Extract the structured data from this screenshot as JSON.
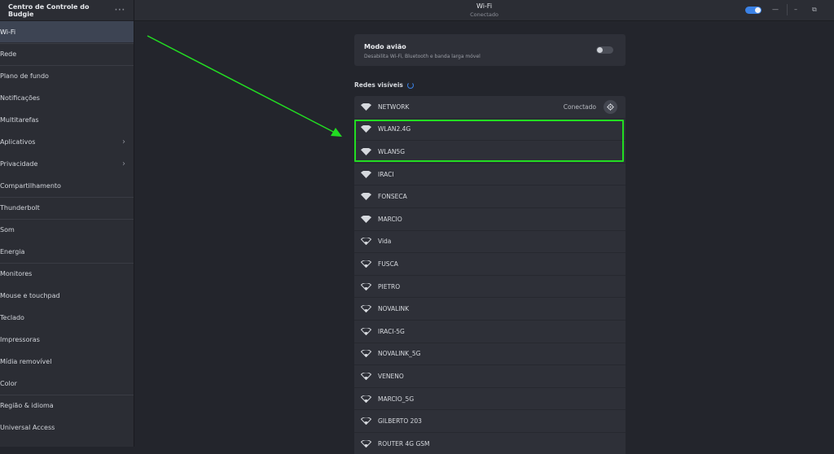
{
  "sidebar": {
    "title": "Centro de Controle do Budgie",
    "menu_icon": "more-dots-icon",
    "items": [
      {
        "label": "Wi-Fi",
        "active": true,
        "chevron": false,
        "sep": false
      },
      {
        "label": "Rede",
        "active": false,
        "chevron": false,
        "sep": true
      },
      {
        "label": "Plano de fundo",
        "active": false,
        "chevron": false,
        "sep": true
      },
      {
        "label": "Notificações",
        "active": false,
        "chevron": false,
        "sep": false
      },
      {
        "label": "Multitarefas",
        "active": false,
        "chevron": false,
        "sep": false
      },
      {
        "label": "Aplicativos",
        "active": false,
        "chevron": true,
        "sep": false
      },
      {
        "label": "Privacidade",
        "active": false,
        "chevron": true,
        "sep": false
      },
      {
        "label": "Compartilhamento",
        "active": false,
        "chevron": false,
        "sep": false
      },
      {
        "label": "Thunderbolt",
        "active": false,
        "chevron": false,
        "sep": true
      },
      {
        "label": "Som",
        "active": false,
        "chevron": false,
        "sep": true
      },
      {
        "label": "Energia",
        "active": false,
        "chevron": false,
        "sep": false
      },
      {
        "label": "Monitores",
        "active": false,
        "chevron": false,
        "sep": true
      },
      {
        "label": "Mouse e touchpad",
        "active": false,
        "chevron": false,
        "sep": false
      },
      {
        "label": "Teclado",
        "active": false,
        "chevron": false,
        "sep": false
      },
      {
        "label": "Impressoras",
        "active": false,
        "chevron": false,
        "sep": false
      },
      {
        "label": "Mídia removível",
        "active": false,
        "chevron": false,
        "sep": false
      },
      {
        "label": "Color",
        "active": false,
        "chevron": false,
        "sep": false
      },
      {
        "label": "Região & idioma",
        "active": false,
        "chevron": false,
        "sep": true
      },
      {
        "label": "Universal Access",
        "active": false,
        "chevron": false,
        "sep": false
      }
    ]
  },
  "titlebar": {
    "title": "Wi-Fi",
    "subtitle": "Conectado",
    "wifi_enabled": true,
    "minimize_label": "—",
    "restore_label": "⧉"
  },
  "airplane": {
    "title": "Modo avião",
    "description": "Desabilita Wi-Fi, Bluetooth e banda larga móvel",
    "enabled": false
  },
  "networks_section": {
    "title": "Redes visíveis"
  },
  "networks": [
    {
      "name": "NETWORK",
      "status": "Conectado",
      "strength": 4,
      "settings": true
    },
    {
      "name": "WLAN2.4G",
      "status": "",
      "strength": 4,
      "settings": false
    },
    {
      "name": "WLAN5G",
      "status": "",
      "strength": 4,
      "settings": false
    },
    {
      "name": "IRACI",
      "status": "",
      "strength": 4,
      "settings": false
    },
    {
      "name": "FONSECA",
      "status": "",
      "strength": 4,
      "settings": false
    },
    {
      "name": "MARCIO",
      "status": "",
      "strength": 4,
      "settings": false
    },
    {
      "name": "Vida",
      "status": "",
      "strength": 1,
      "settings": false
    },
    {
      "name": "FUSCA",
      "status": "",
      "strength": 1,
      "settings": false
    },
    {
      "name": "PIETRO",
      "status": "",
      "strength": 1,
      "settings": false
    },
    {
      "name": "NOVALINK",
      "status": "",
      "strength": 1,
      "settings": false
    },
    {
      "name": "IRACI-5G",
      "status": "",
      "strength": 1,
      "settings": false
    },
    {
      "name": "NOVALINK_5G",
      "status": "",
      "strength": 1,
      "settings": false
    },
    {
      "name": "VENENO",
      "status": "",
      "strength": 1,
      "settings": false
    },
    {
      "name": "MARCIO_5G",
      "status": "",
      "strength": 1,
      "settings": false
    },
    {
      "name": "GILBERTO 203",
      "status": "",
      "strength": 1,
      "settings": false
    },
    {
      "name": "ROUTER 4G GSM",
      "status": "",
      "strength": 1,
      "settings": false
    }
  ],
  "colors": {
    "accent": "#3b82e6",
    "annotation": "#22dd22",
    "active_item": "#3d4453"
  }
}
